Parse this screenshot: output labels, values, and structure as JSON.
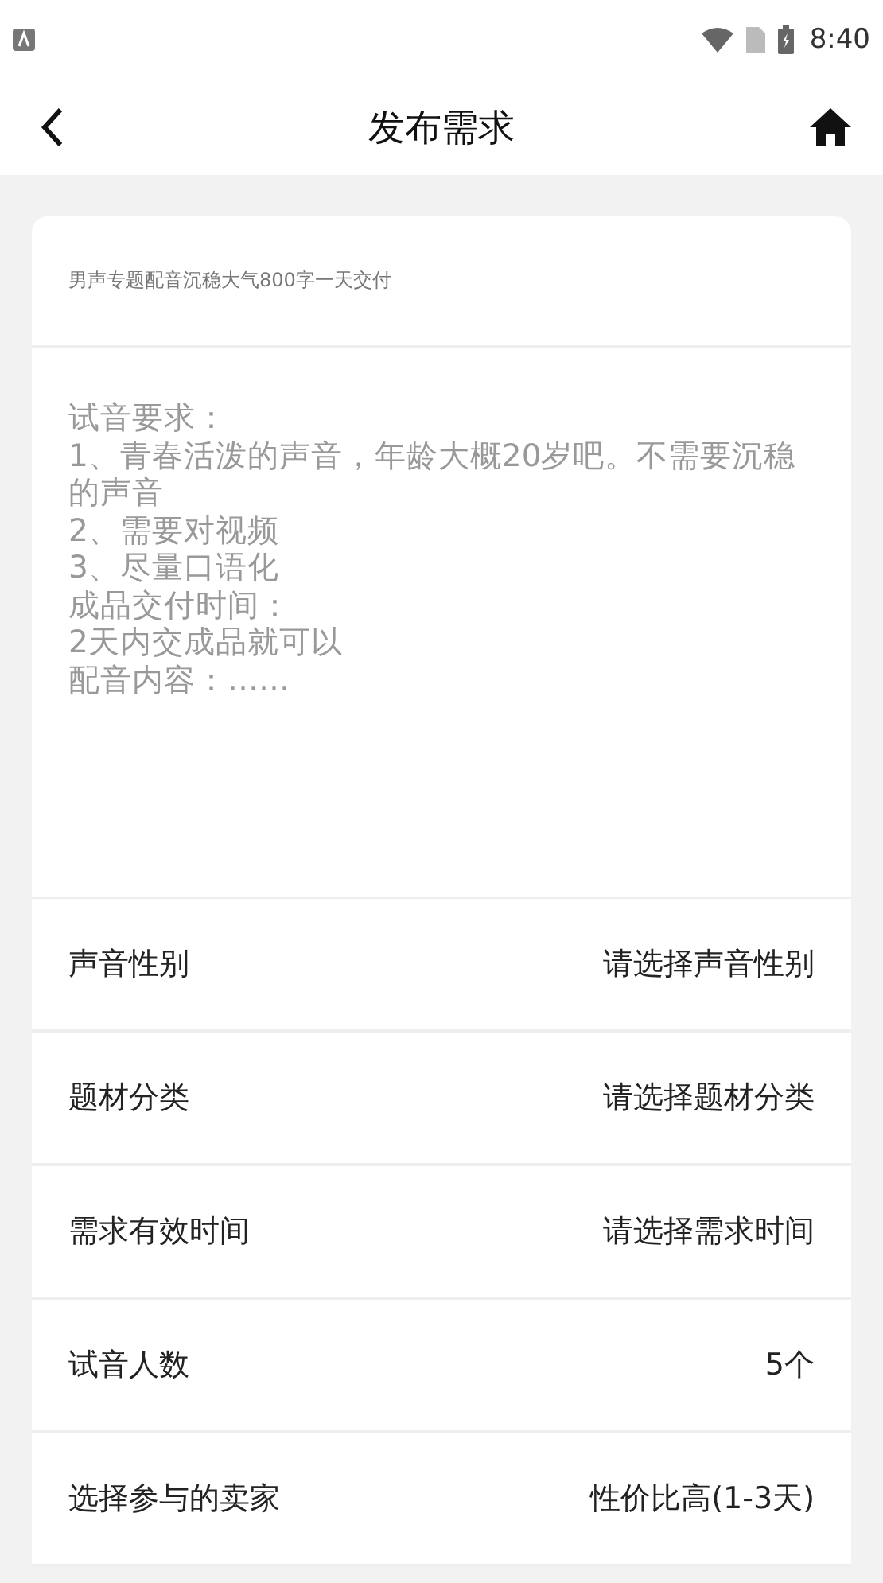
{
  "status_bar": {
    "time": "8:40"
  },
  "header": {
    "title": "发布需求"
  },
  "form": {
    "title_value": "男声专题配音沉稳大气800字一天交付",
    "description_lines": [
      "试音要求：",
      "1、青春活泼的声音，年龄大概20岁吧。不需要沉稳的声音",
      "2、需要对视频",
      "3、尽量口语化",
      "成品交付时间：",
      "2天内交成品就可以",
      "配音内容：……"
    ],
    "rows": [
      {
        "label": "声音性别",
        "value": "请选择声音性别"
      },
      {
        "label": "题材分类",
        "value": "请选择题材分类"
      },
      {
        "label": "需求有效时间",
        "value": "请选择需求时间"
      },
      {
        "label": "试音人数",
        "value": "5个"
      },
      {
        "label": "选择参与的卖家",
        "value": "性价比高(1-3天)"
      }
    ]
  }
}
